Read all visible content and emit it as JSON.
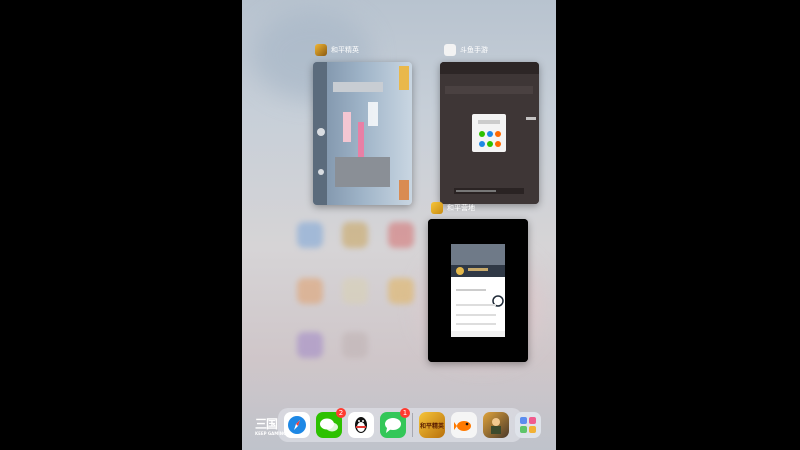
{
  "switcher": {
    "cards": [
      {
        "app_name": "和平精英",
        "type": "game"
      },
      {
        "app_name": "斗鱼手游",
        "type": "stream"
      },
      {
        "app_name": "和平营地",
        "type": "companion"
      }
    ]
  },
  "dock": {
    "apps": [
      {
        "name": "safari-icon",
        "badge": ""
      },
      {
        "name": "wechat-icon",
        "badge": "2"
      },
      {
        "name": "qq-icon",
        "badge": ""
      },
      {
        "name": "messages-icon",
        "badge": "1"
      }
    ],
    "recent_apps": [
      {
        "name": "heping-jingying-icon",
        "label": "和平精英"
      },
      {
        "name": "douyu-icon",
        "label": ""
      },
      {
        "name": "pubg-game-icon",
        "label": ""
      },
      {
        "name": "app-library-icon",
        "label": ""
      }
    ]
  },
  "watermark": {
    "big": "三国",
    "small": "KEEP GAMING"
  },
  "colors": {
    "badge": "#ff3b30",
    "wechat": "#2dc100",
    "safari": "#1e88e5",
    "messages": "#34c759"
  }
}
